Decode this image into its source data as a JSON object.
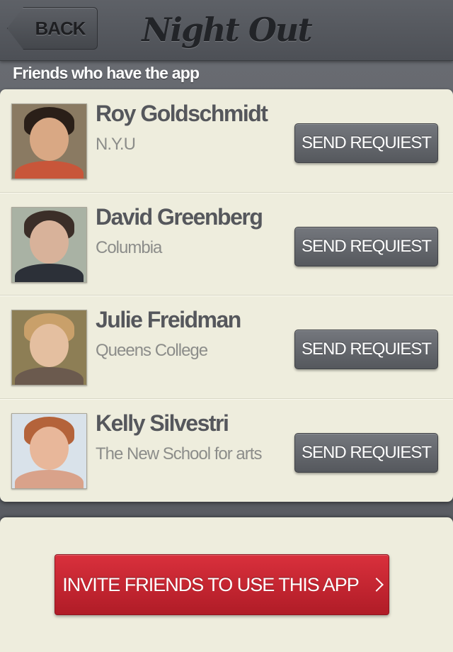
{
  "navbar": {
    "back_label": "BACK",
    "title": "Night Out"
  },
  "section_header": "Friends who have the app",
  "friends": [
    {
      "name": "Roy Goldschmidt",
      "school": "N.Y.U",
      "button_label": "SEND REQUIEST",
      "avatar": {
        "bg": "#8a7a62",
        "face": "#d9a884",
        "hair": "#2a1f18",
        "shoulders": "#c8563a"
      }
    },
    {
      "name": "David Greenberg",
      "school": "Columbia",
      "button_label": "SEND REQUIEST",
      "avatar": {
        "bg": "#a9b2a4",
        "face": "#d8b29a",
        "hair": "#3b2e28",
        "shoulders": "#2c3038"
      }
    },
    {
      "name": "Julie Freidman",
      "school": "Queens College",
      "button_label": "SEND REQUIEST",
      "avatar": {
        "bg": "#8d7e55",
        "face": "#e4bfa0",
        "hair": "#c9a06a",
        "shoulders": "#6b5a4e"
      }
    },
    {
      "name": "Kelly Silvestri",
      "school": "The New School for arts",
      "button_label": "SEND REQUIEST",
      "avatar": {
        "bg": "#d9e2ea",
        "face": "#e8b79a",
        "hair": "#b4633a",
        "shoulders": "#d9a28a"
      }
    }
  ],
  "invite": {
    "label": "INVITE FRIENDS TO USE THIS APP"
  },
  "colors": {
    "accent_red": "#c62433",
    "button_gray": "#60636a",
    "card_bg": "#eeeddd"
  }
}
